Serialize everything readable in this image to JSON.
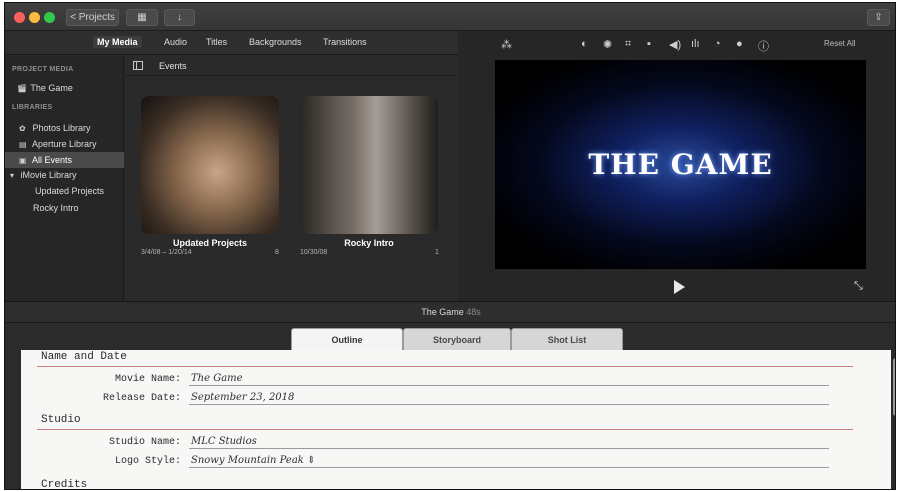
{
  "toolbar": {
    "projects_label": "< Projects",
    "clips_icon": "clip-appearance-icon",
    "import_icon": "import-arrow-icon",
    "share_icon": "share-icon"
  },
  "browser": {
    "tabs": [
      "My Media",
      "Audio",
      "Titles",
      "Backgrounds",
      "Transitions"
    ],
    "active_tab": "My Media"
  },
  "sidebar": {
    "project_media_heading": "PROJECT MEDIA",
    "project_item": "The Game",
    "libraries_heading": "LIBRARIES",
    "items": [
      {
        "label": "Photos Library",
        "icon": "photos-icon"
      },
      {
        "label": "Aperture Library",
        "icon": "aperture-icon"
      },
      {
        "label": "All Events",
        "icon": "events-icon"
      },
      {
        "label": "iMovie Library",
        "icon": "disclosure-triangle-icon"
      },
      {
        "label": "Updated Projects"
      },
      {
        "label": "Rocky Intro"
      }
    ]
  },
  "events": {
    "label": "Events",
    "clips": [
      {
        "title": "Updated Projects",
        "date": "3/4/08 – 1/20/14",
        "count": "8"
      },
      {
        "title": "Rocky Intro",
        "date": "10/30/08",
        "count": "1"
      }
    ]
  },
  "viewer": {
    "reset_all": "Reset All",
    "title_text": "THE GAME",
    "tools": [
      "magic-wand-icon",
      "color-balance-icon",
      "color-correction-icon",
      "crop-icon",
      "stabilization-icon",
      "volume-icon",
      "noise-reduction-icon",
      "speed-icon",
      "clip-filter-icon",
      "info-icon"
    ]
  },
  "project": {
    "name": "The Game",
    "duration": "48s"
  },
  "sheet_tabs": [
    "Outline",
    "Storyboard",
    "Shot List"
  ],
  "outline": {
    "sections": [
      "Name and Date",
      "Studio",
      "Credits"
    ],
    "fields": [
      {
        "label": "Movie Name:",
        "value": "The Game"
      },
      {
        "label": "Release Date:",
        "value": "September 23, 2018"
      },
      {
        "label": "Studio Name:",
        "value": "MLC Studios"
      },
      {
        "label": "Logo Style:",
        "value": "Snowy Mountain Peak ⇕"
      }
    ]
  }
}
